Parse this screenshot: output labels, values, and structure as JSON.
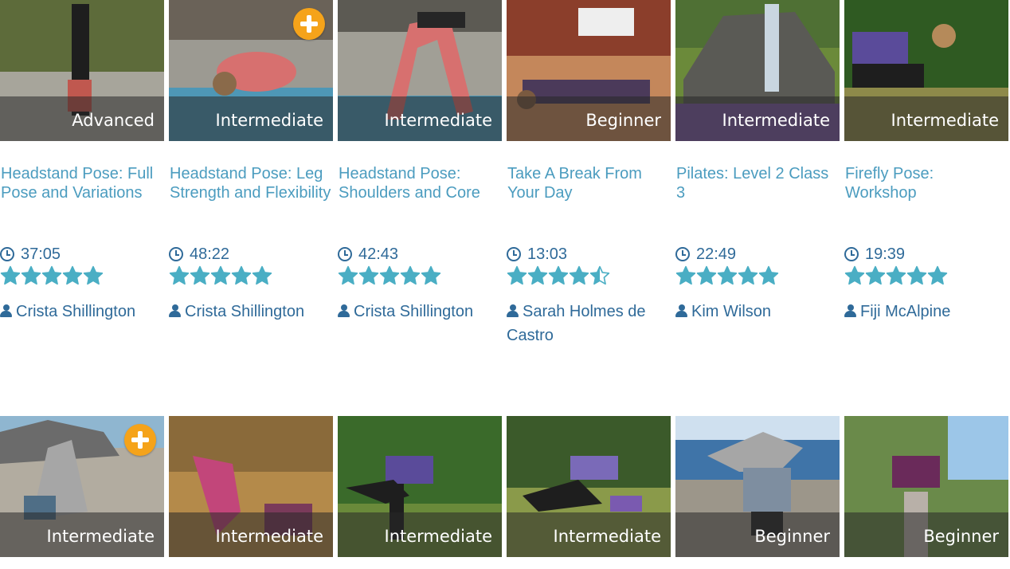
{
  "colors": {
    "accent": "#4b9cbf",
    "author": "#2f6a99",
    "star": "#4aaec4",
    "plus_badge": "#f5a31a",
    "overlay": "rgba(40,40,40,0.55)"
  },
  "top_row": [
    {
      "level": "Advanced",
      "title": "Headstand Pose: Full Pose and Variations",
      "duration": "37:05",
      "rating": 5,
      "author": "Crista Shillington",
      "has_plus": false
    },
    {
      "level": "Intermediate",
      "title": "Headstand Pose: Leg Strength and Flexibility",
      "duration": "48:22",
      "rating": 5,
      "author": "Crista Shillington",
      "has_plus": true
    },
    {
      "level": "Intermediate",
      "title": "Headstand Pose: Shoulders and Core",
      "duration": "42:43",
      "rating": 5,
      "author": "Crista Shillington",
      "has_plus": false
    },
    {
      "level": "Beginner",
      "title": "Take A Break From Your Day",
      "duration": "13:03",
      "rating": 4.5,
      "author": "Sarah Holmes de Castro",
      "has_plus": false
    },
    {
      "level": "Intermediate",
      "title": "Pilates: Level 2 Class 3",
      "duration": "22:49",
      "rating": 5,
      "author": "Kim Wilson",
      "has_plus": false
    },
    {
      "level": "Intermediate",
      "title": "Firefly Pose: Workshop",
      "duration": "19:39",
      "rating": 5,
      "author": "Fiji McAlpine",
      "has_plus": false
    }
  ],
  "bottom_row": [
    {
      "level": "Intermediate",
      "has_plus": true
    },
    {
      "level": "Intermediate",
      "has_plus": false
    },
    {
      "level": "Intermediate",
      "has_plus": false
    },
    {
      "level": "Intermediate",
      "has_plus": false
    },
    {
      "level": "Beginner",
      "has_plus": false
    },
    {
      "level": "Beginner",
      "has_plus": false
    }
  ],
  "icons": {
    "plus": "plus-icon",
    "clock": "clock-icon",
    "star": "star-icon",
    "person": "person-icon"
  }
}
